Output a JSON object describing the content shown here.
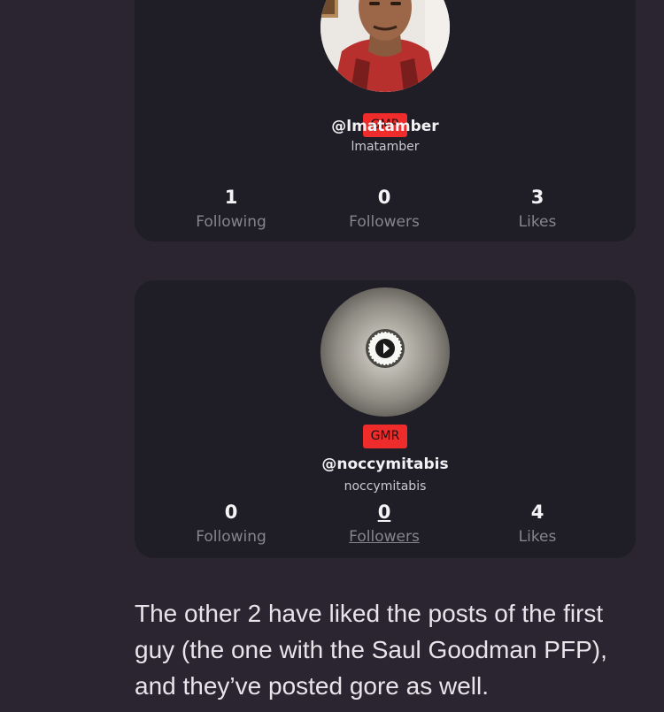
{
  "profiles": [
    {
      "badge": "GMR",
      "handle": "@lmatamber",
      "username": "lmatamber",
      "stats": {
        "following": {
          "value": "1",
          "label": "Following"
        },
        "followers": {
          "value": "0",
          "label": "Followers"
        },
        "likes": {
          "value": "3",
          "label": "Likes"
        }
      }
    },
    {
      "badge": "GMR",
      "handle": "@noccymitabis",
      "username": "noccymitabis",
      "stats": {
        "following": {
          "value": "0",
          "label": "Following"
        },
        "followers": {
          "value": "0",
          "label": "Followers"
        },
        "likes": {
          "value": "4",
          "label": "Likes"
        }
      }
    }
  ],
  "paragraph": "The other 2 have liked the posts of the first guy (the one with the Saul Goodman PFP), and they’ve posted gore as well.",
  "colors": {
    "background": "#2a2530",
    "card": "#1f1e26",
    "badge": "#ef2c2c",
    "label": "#85858f"
  }
}
